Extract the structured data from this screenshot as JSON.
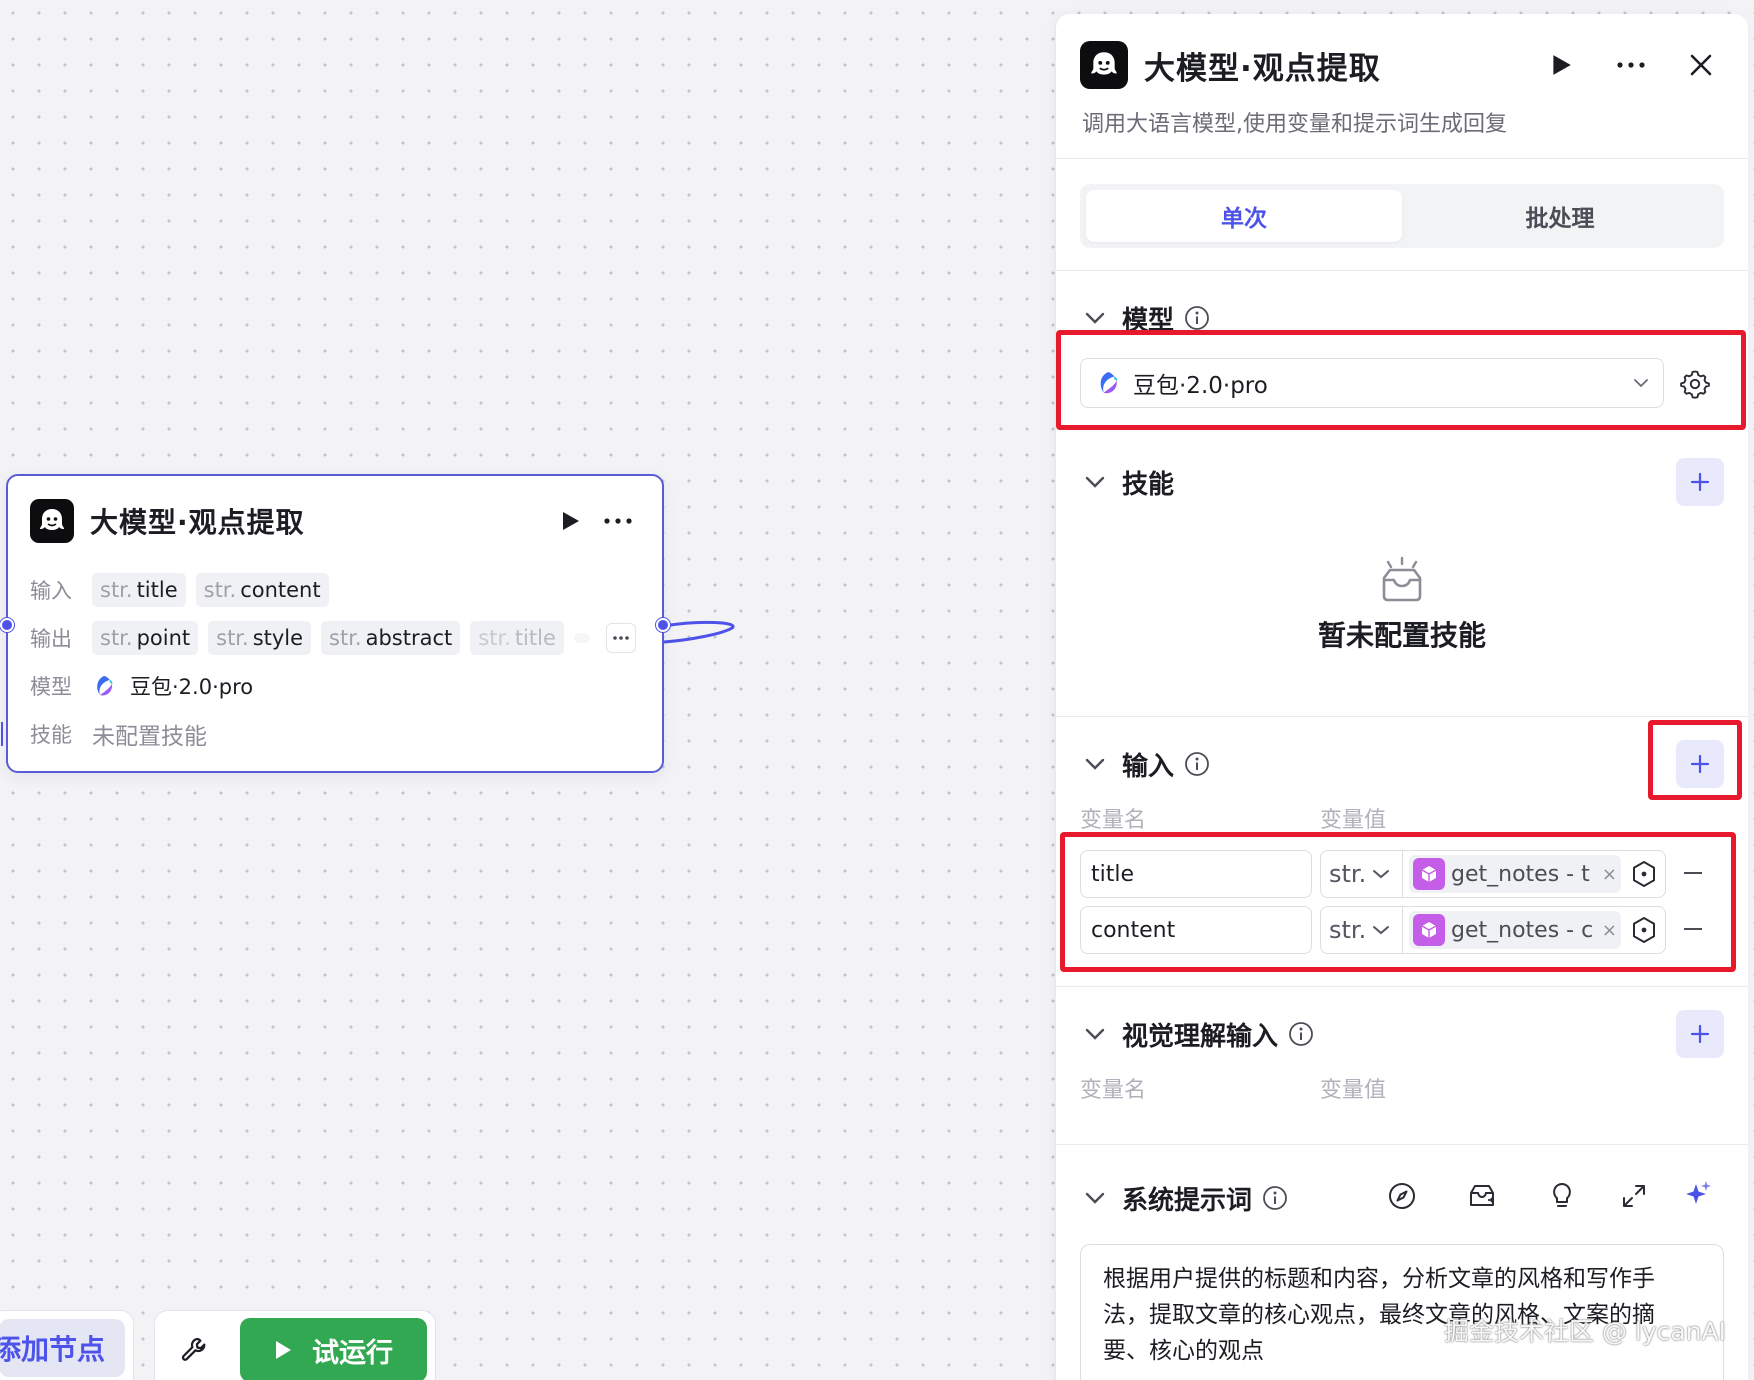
{
  "node": {
    "title": "大模型·观点提取",
    "input_label": "输入",
    "inputs": [
      {
        "type": "str.",
        "name": "title"
      },
      {
        "type": "str.",
        "name": "content"
      }
    ],
    "output_label": "输出",
    "outputs": [
      {
        "type": "str.",
        "name": "point"
      },
      {
        "type": "str.",
        "name": "style"
      },
      {
        "type": "str.",
        "name": "abstract"
      },
      {
        "type": "str.",
        "name": "title"
      }
    ],
    "model_label": "模型",
    "model_name": "豆包·2.0·pro",
    "skill_label": "技能",
    "skill_value": "未配置技能"
  },
  "toolbar": {
    "add_node_label": "添加节点",
    "trial_run_label": "试运行"
  },
  "panel": {
    "title": "大模型·观点提取",
    "description": "调用大语言模型,使用变量和提示词生成回复",
    "tabs": [
      "单次",
      "批处理"
    ],
    "active_tab": "单次",
    "model_section": {
      "title": "模型",
      "selected": "豆包·2.0·pro"
    },
    "skill_section": {
      "title": "技能",
      "empty_text": "暂未配置技能"
    },
    "input_section": {
      "title": "输入",
      "col_name": "变量名",
      "col_value": "变量值",
      "rows": [
        {
          "name": "title",
          "type": "str.",
          "ref": "get_notes - t"
        },
        {
          "name": "content",
          "type": "str.",
          "ref": "get_notes - c"
        }
      ]
    },
    "vision_section": {
      "title": "视觉理解输入",
      "col_name": "变量名",
      "col_value": "变量值"
    },
    "system_prompt": {
      "title": "系统提示词",
      "lines": [
        "根据用户提供的标题和内容，分析文章的风格和写作手",
        "法，提取文章的核心观点，最终文章的风格、文案的摘",
        "要、核心的观点"
      ]
    }
  },
  "watermark": "掘金技术社区 @ lycanAI",
  "colors": {
    "accent": "#4d53e8",
    "run_green": "#32a852",
    "highlight_red": "#e8192c",
    "ref_purple": "#c45ee8"
  }
}
